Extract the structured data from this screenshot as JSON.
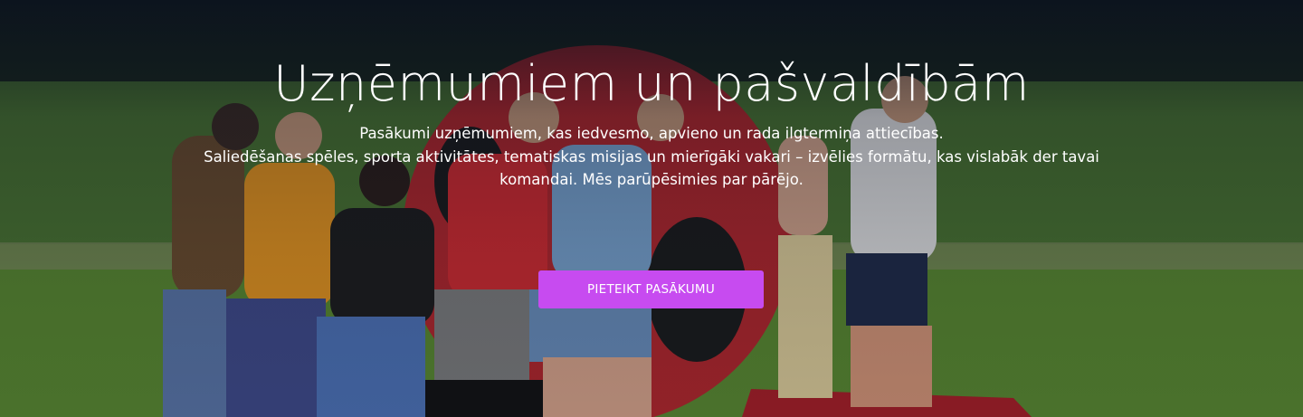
{
  "hero": {
    "title": "Uzņēmumiem un pašvaldībām",
    "subtitle_line1": "Pasākumi uzņēmumiem, kas iedvesmo, apvieno un rada ilgtermiņa attiecības.",
    "subtitle_line2": "Saliedēšanas spēles, sporta aktivitātes, tematiskas misijas un mierīgāki vakari – izvēlies formātu, kas vislabāk der tavai",
    "subtitle_line3": "komandai. Mēs parūpēsimies par pārējo.",
    "cta_label": "PIETEIKT PASĀKUMU",
    "background_image": "team-building-outdoor-photo",
    "colors": {
      "cta_background": "#c74bf0",
      "text": "#ffffff",
      "overlay": "#080e1e"
    }
  }
}
